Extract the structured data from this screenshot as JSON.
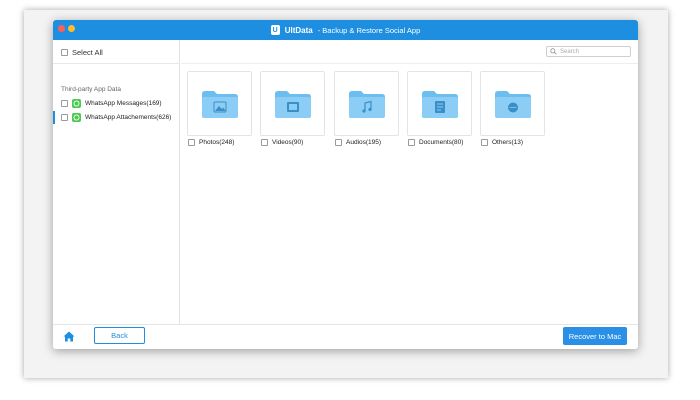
{
  "window": {
    "brand": "UltData",
    "title_rest": "- Backup & Restore Social App",
    "logo_letter": "U"
  },
  "sidebar": {
    "select_all": "Select All",
    "section_title": "Third-party App Data",
    "items": [
      {
        "label": "WhatsApp Messages(169)",
        "icon": "whatsapp-icon",
        "active": false
      },
      {
        "label": "WhatsApp Attachements(626)",
        "icon": "whatsapp-icon",
        "active": true
      }
    ]
  },
  "search": {
    "placeholder": "Search"
  },
  "categories": [
    {
      "label": "Photos(248)",
      "icon": "image-folder-icon"
    },
    {
      "label": "Videos(90)",
      "icon": "video-folder-icon"
    },
    {
      "label": "Audios(195)",
      "icon": "music-folder-icon"
    },
    {
      "label": "Documents(80)",
      "icon": "document-folder-icon"
    },
    {
      "label": "Others(13)",
      "icon": "other-folder-icon"
    }
  ],
  "footer": {
    "back_label": "Back",
    "recover_label": "Recover to Mac"
  },
  "colors": {
    "accent": "#1e8fe0",
    "folder": "#6cbdf0",
    "whatsapp": "#4cc94f"
  }
}
